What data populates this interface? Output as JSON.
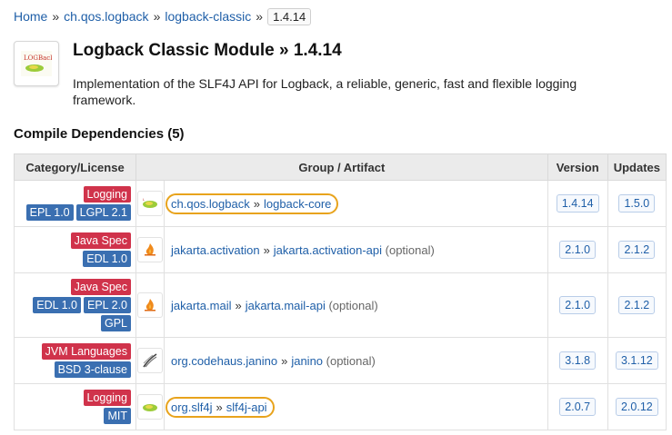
{
  "breadcrumb": {
    "items": [
      "Home",
      "ch.qos.logback",
      "logback-classic"
    ],
    "separator": "»",
    "current": "1.4.14"
  },
  "header": {
    "title": "Logback Classic Module » 1.4.14",
    "description": "Implementation of the SLF4J API for Logback, a reliable, generic, fast and flexible logging framework.",
    "logo_text": "LOGBack"
  },
  "section_title": "Compile Dependencies (5)",
  "table": {
    "headers": {
      "category": "Category/License",
      "artifact": "Group / Artifact",
      "version": "Version",
      "updates": "Updates"
    },
    "arrow": "»",
    "rows": [
      {
        "badges": [
          [
            "Logging"
          ],
          [
            "EPL 1.0",
            "LGPL 2.1"
          ]
        ],
        "badge_colors": [
          [
            "red"
          ],
          [
            "blue",
            "blue"
          ]
        ],
        "icon": "logback-icon",
        "group": "ch.qos.logback",
        "artifact": "logback-core",
        "optional": "",
        "version": "1.4.14",
        "update": "1.5.0",
        "highlighted": true
      },
      {
        "badges": [
          [
            "Java Spec"
          ],
          [
            "EDL 1.0"
          ]
        ],
        "badge_colors": [
          [
            "red"
          ],
          [
            "blue"
          ]
        ],
        "icon": "jakarta-flame-icon",
        "group": "jakarta.activation",
        "artifact": "jakarta.activation-api",
        "optional": "(optional)",
        "version": "2.1.0",
        "update": "2.1.2",
        "highlighted": false
      },
      {
        "badges": [
          [
            "Java Spec"
          ],
          [
            "EDL 1.0",
            "EPL 2.0"
          ],
          [
            "GPL"
          ]
        ],
        "badge_colors": [
          [
            "red"
          ],
          [
            "blue",
            "blue"
          ],
          [
            "blue"
          ]
        ],
        "icon": "jakarta-flame-icon",
        "group": "jakarta.mail",
        "artifact": "jakarta.mail-api",
        "optional": "(optional)",
        "version": "2.1.0",
        "update": "2.1.2",
        "highlighted": false
      },
      {
        "badges": [
          [
            "JVM Languages"
          ],
          [
            "BSD 3-clause"
          ]
        ],
        "badge_colors": [
          [
            "red"
          ],
          [
            "blue"
          ]
        ],
        "icon": "janino-icon",
        "group": "org.codehaus.janino",
        "artifact": "janino",
        "optional": "(optional)",
        "version": "3.1.8",
        "update": "3.1.12",
        "highlighted": false
      },
      {
        "badges": [
          [
            "Logging"
          ],
          [
            "MIT"
          ]
        ],
        "badge_colors": [
          [
            "red"
          ],
          [
            "blue"
          ]
        ],
        "icon": "slf4j-icon",
        "group": "org.slf4j",
        "artifact": "slf4j-api",
        "optional": "",
        "version": "2.0.7",
        "update": "2.0.12",
        "highlighted": true
      }
    ]
  },
  "colors": {
    "link": "#1f5fa8",
    "category_badge": "#d0334b",
    "license_badge": "#3a6fb1",
    "highlight_outline": "#e8a31c"
  }
}
